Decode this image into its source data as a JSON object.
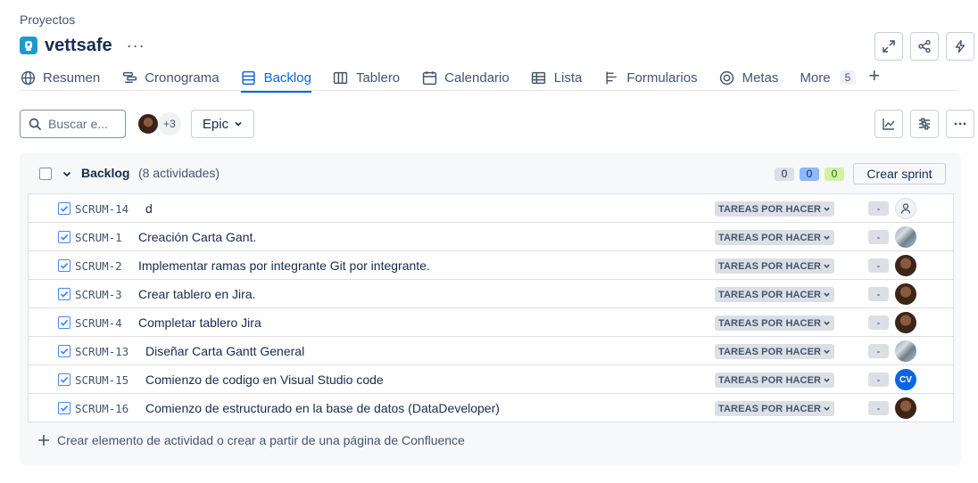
{
  "breadcrumb": "Proyectos",
  "project": {
    "name": "vettsafe",
    "more": "···"
  },
  "header_buttons": [
    {
      "name": "fullscreen-icon"
    },
    {
      "name": "share-icon"
    },
    {
      "name": "automation-icon"
    }
  ],
  "tabs": [
    {
      "label": "Resumen",
      "icon": "globe-icon"
    },
    {
      "label": "Cronograma",
      "icon": "timeline-icon"
    },
    {
      "label": "Backlog",
      "icon": "backlog-icon",
      "active": true
    },
    {
      "label": "Tablero",
      "icon": "board-icon"
    },
    {
      "label": "Calendario",
      "icon": "calendar-icon"
    },
    {
      "label": "Lista",
      "icon": "list-icon"
    },
    {
      "label": "Formularios",
      "icon": "forms-icon"
    },
    {
      "label": "Metas",
      "icon": "goals-icon"
    },
    {
      "label": "More",
      "badge": "5"
    }
  ],
  "toolbar": {
    "search_placeholder": "Buscar e...",
    "avatars_more": "+3",
    "epic_label": "Epic"
  },
  "backlog": {
    "title": "Backlog",
    "count_text": "(8 actividades)",
    "counts": {
      "todo": "0",
      "in_progress": "0",
      "done": "0"
    },
    "create_sprint": "Crear sprint",
    "items": [
      {
        "key": "SCRUM-14",
        "summary": "d",
        "status": "TAREAS POR HACER",
        "estimate": "-",
        "assignee": "unassigned"
      },
      {
        "key": "SCRUM-1",
        "summary": "Creación Carta Gant.",
        "status": "TAREAS POR HACER",
        "estimate": "-",
        "assignee": "photo"
      },
      {
        "key": "SCRUM-2",
        "summary": "Implementar ramas por integrante Git por integrante.",
        "status": "TAREAS POR HACER",
        "estimate": "-",
        "assignee": "dark"
      },
      {
        "key": "SCRUM-3",
        "summary": "Crear tablero en Jira.",
        "status": "TAREAS POR HACER",
        "estimate": "-",
        "assignee": "dark"
      },
      {
        "key": "SCRUM-4",
        "summary": "Completar tablero Jira",
        "status": "TAREAS POR HACER",
        "estimate": "-",
        "assignee": "dark"
      },
      {
        "key": "SCRUM-13",
        "summary": "Diseñar Carta Gantt General",
        "status": "TAREAS POR HACER",
        "estimate": "-",
        "assignee": "photo"
      },
      {
        "key": "SCRUM-15",
        "summary": "Comienzo de codigo en Visual Studio code",
        "status": "TAREAS POR HACER",
        "estimate": "-",
        "assignee": "CV"
      },
      {
        "key": "SCRUM-16",
        "summary": "Comienzo de estructurado en la base de datos (DataDeveloper)",
        "status": "TAREAS POR HACER",
        "estimate": "-",
        "assignee": "dark"
      }
    ],
    "create_label": "Crear elemento de actividad o crear a partir de una página de Confluence"
  },
  "colors": {
    "accent": "#0c66e4",
    "text": "#172b4d",
    "subtle": "#44546f"
  }
}
